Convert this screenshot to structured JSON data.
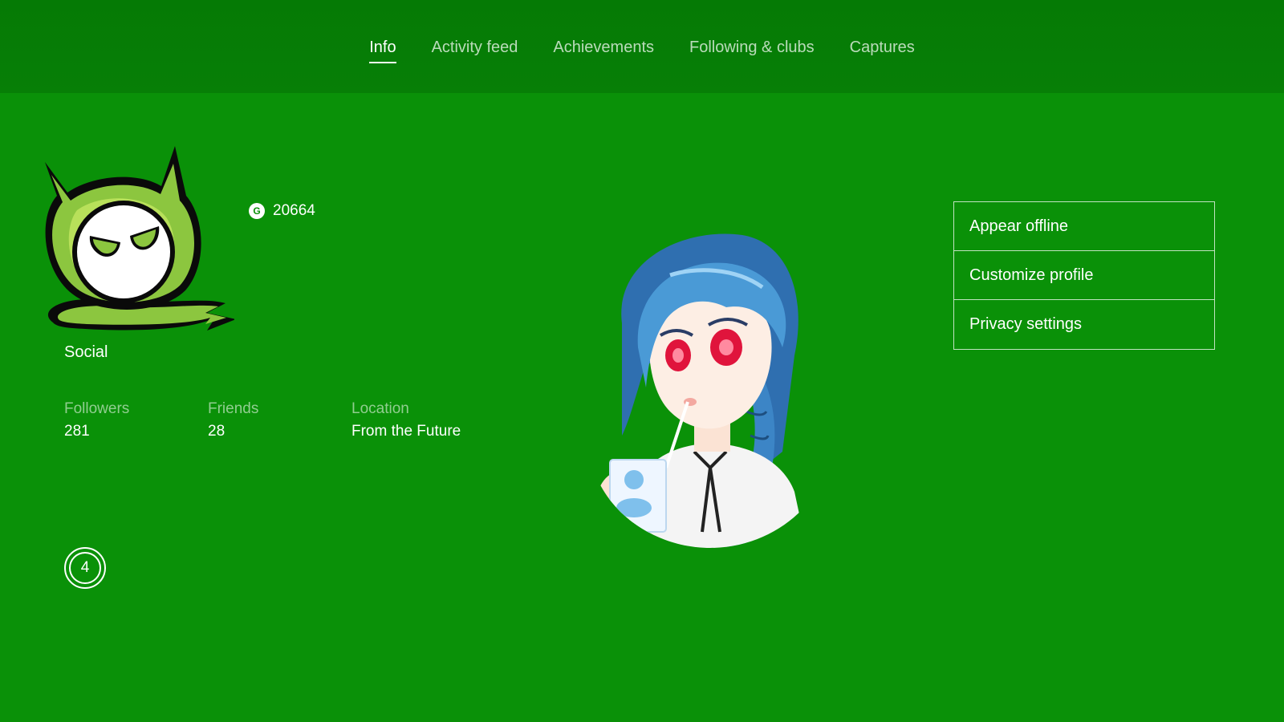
{
  "nav": {
    "tabs": [
      {
        "label": "Info",
        "active": true
      },
      {
        "label": "Activity feed",
        "active": false
      },
      {
        "label": "Achievements",
        "active": false
      },
      {
        "label": "Following & clubs",
        "active": false
      },
      {
        "label": "Captures",
        "active": false
      }
    ]
  },
  "profile": {
    "gamerscore_icon": "G",
    "gamerscore": "20664",
    "social_label": "Social",
    "stats": [
      {
        "label": "Followers",
        "value": "281"
      },
      {
        "label": "Friends",
        "value": "28"
      },
      {
        "label": "Location",
        "value": "From the Future"
      }
    ],
    "level": "4",
    "gamerpic_icon": "devil-mascot-icon",
    "avatar_icon": "anime-avatar-image"
  },
  "actions": {
    "appear_offline": "Appear offline",
    "customize_profile": "Customize profile",
    "privacy_settings": "Privacy settings"
  },
  "colors": {
    "background": "#0a9108",
    "topbar": "#067c05",
    "text": "#ffffff"
  }
}
